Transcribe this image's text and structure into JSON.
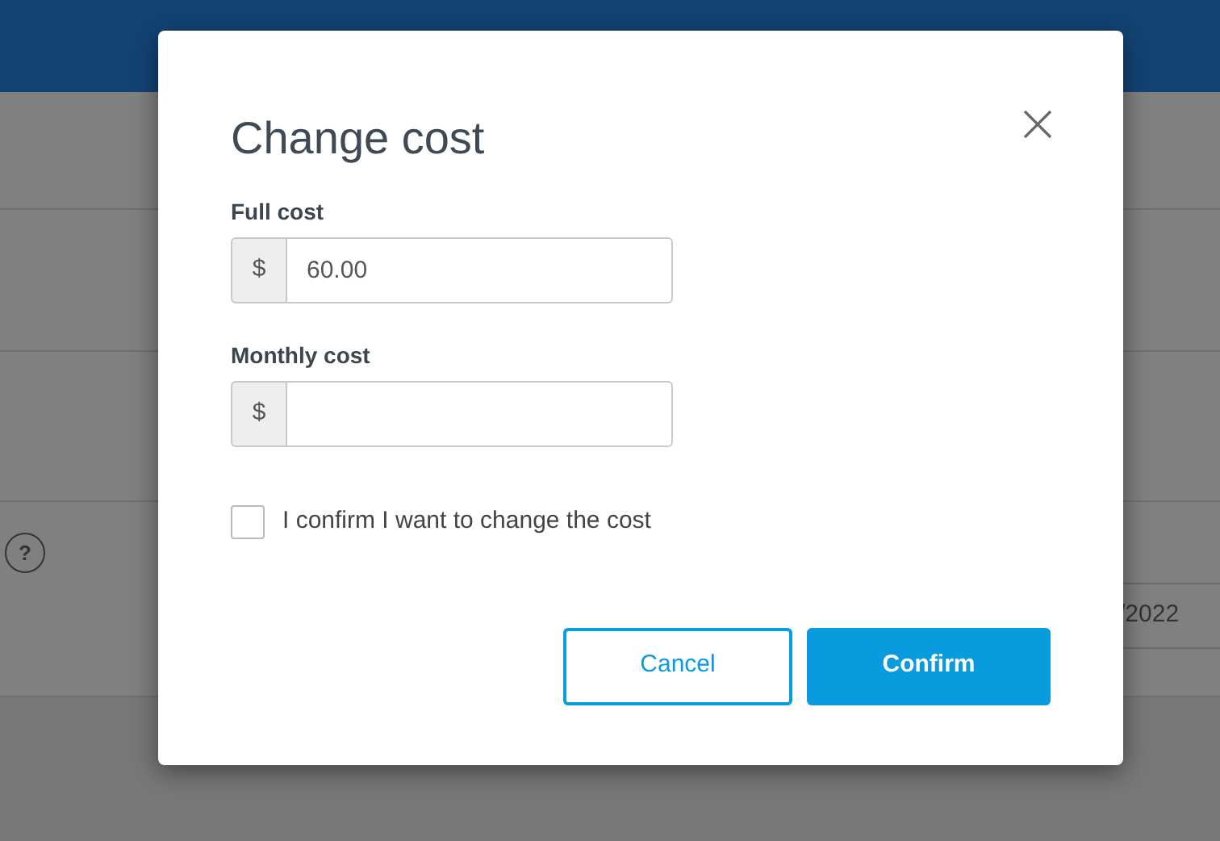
{
  "background": {
    "help_icon": "?",
    "date_field": "/2022"
  },
  "dialog": {
    "title": "Change cost",
    "fields": [
      {
        "label": "Full cost",
        "prefix": "$",
        "value": "60.00"
      },
      {
        "label": "Monthly cost",
        "prefix": "$"
      }
    ],
    "confirm_checkbox": {
      "label": "I confirm I want to change the cost",
      "checked": false
    },
    "buttons": [
      {
        "label": "Cancel",
        "kind": "secondary"
      },
      {
        "label": "Confirm",
        "kind": "primary"
      }
    ]
  }
}
